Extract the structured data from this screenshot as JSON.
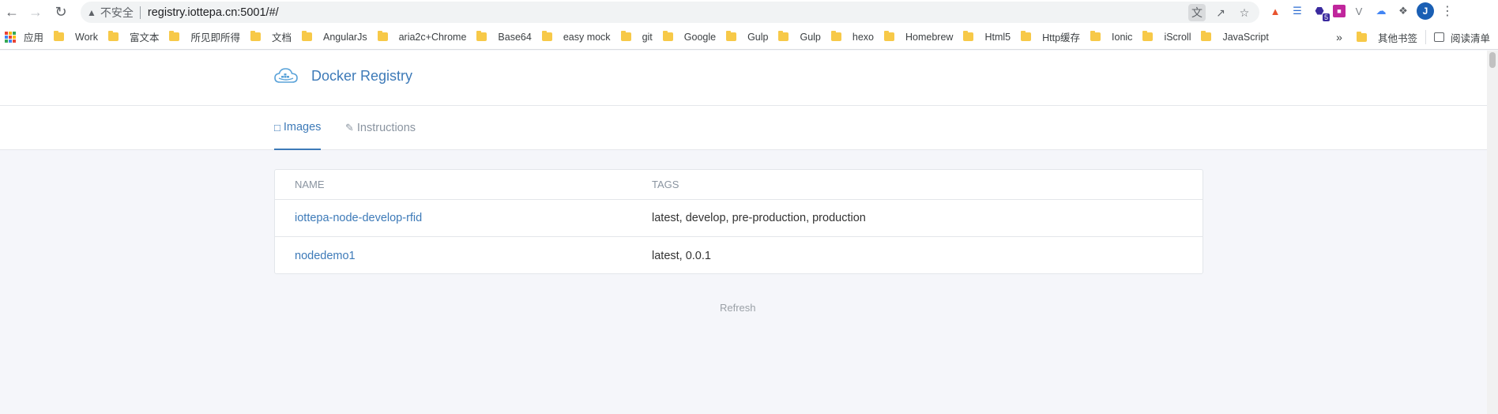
{
  "browser": {
    "security_label": "不安全",
    "url": "registry.iottepa.cn:5001/#/",
    "avatar_letter": "J",
    "ext_badge": "5"
  },
  "bookmarks": {
    "apps_label": "应用",
    "items": [
      "Work",
      "富文本",
      "所见即所得",
      "文档",
      "AngularJs",
      "aria2c+Chrome",
      "Base64",
      "easy mock",
      "git",
      "Google",
      "Gulp",
      "Gulp",
      "hexo",
      "Homebrew",
      "Html5",
      "Http缓存",
      "Ionic",
      "iScroll",
      "JavaScript"
    ],
    "more": "»",
    "other": "其他书签",
    "reading_list": "阅读清单"
  },
  "app": {
    "title": "Docker Registry",
    "accent": "#3d7ab8"
  },
  "tabs": [
    {
      "label": "Images",
      "icon": "cube-icon",
      "active": true
    },
    {
      "label": "Instructions",
      "icon": "pen-icon",
      "active": false
    }
  ],
  "table": {
    "columns": [
      "NAME",
      "TAGS"
    ],
    "rows": [
      {
        "name": "iottepa-node-develop-rfid",
        "tags": "latest, develop, pre-production, production"
      },
      {
        "name": "nodedemo1",
        "tags": "latest, 0.0.1"
      }
    ]
  },
  "refresh_label": "Refresh"
}
